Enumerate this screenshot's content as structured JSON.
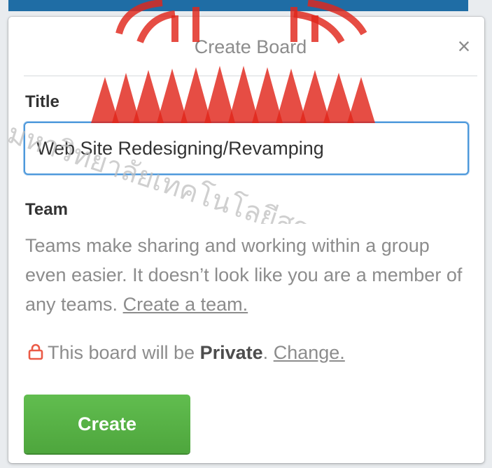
{
  "popover": {
    "title": "Create Board",
    "close_glyph": "×"
  },
  "form": {
    "title_label": "Title",
    "title_value": "Web Site Redesigning/Revamping",
    "team_label": "Team",
    "team_description": "Teams make sharing and working within a group even easier. It doesn’t look like you are a member of any teams.",
    "create_team_link": "Create a team.",
    "privacy_prefix": "This board will be",
    "privacy_value": "Private",
    "privacy_period": ".",
    "change_link": "Change.",
    "create_button": "Create"
  },
  "watermark": {
    "text": "มหาวิทยาลัยเทคโนโลยีสุรนารี"
  },
  "icons": {
    "close": "close-icon",
    "lock": "lock-icon"
  },
  "colors": {
    "topbar": "#1f6da5",
    "create_button": "#5aac44",
    "input_focus": "#4d99db",
    "lock": "#eb5a46",
    "watermark": "#e0261b"
  }
}
